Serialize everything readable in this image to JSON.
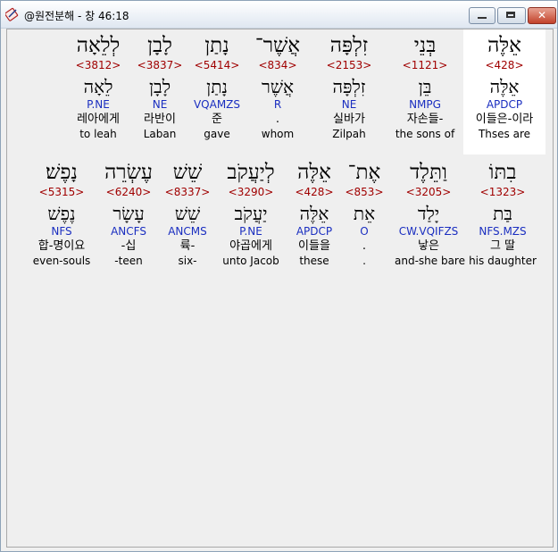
{
  "window": {
    "title": "@원전분해 - 창 46:18",
    "close_glyph": "✕"
  },
  "row1": [
    {
      "heb": "אֵלֶּה",
      "strong": "<428>",
      "lemma": "אֵלֶּה",
      "morph": "APDCP",
      "kor": "이들은-이라",
      "eng": "Thses are"
    },
    {
      "heb": "בְּנֵי",
      "strong": "<1121>",
      "lemma": "בֵּן",
      "morph": "NMPG",
      "kor": "자손들-",
      "eng": "the sons of"
    },
    {
      "heb": "זִלְפָּה",
      "strong": "<2153>",
      "lemma": "זִלְפָּה",
      "morph": "NE",
      "kor": "실바가",
      "eng": "Zilpah"
    },
    {
      "heb": "אֲשֶׁר־",
      "strong": "<834>",
      "lemma": "אֲשֶׁר",
      "morph": "R",
      "kor": ".",
      "eng": "whom"
    },
    {
      "heb": "נָתַן",
      "strong": "<5414>",
      "lemma": "נָתַן",
      "morph": "VQAMZS",
      "kor": "준",
      "eng": "gave"
    },
    {
      "heb": "לָבָן",
      "strong": "<3837>",
      "lemma": "לָבָן",
      "morph": "NE",
      "kor": "라반이",
      "eng": "Laban"
    },
    {
      "heb": "לְלֵאָה",
      "strong": "<3812>",
      "lemma": "לֵאָה",
      "morph": "P.NE",
      "kor": "레아에게",
      "eng": "to leah"
    }
  ],
  "row2": [
    {
      "heb": "בִתּוֹ",
      "strong": "<1323>",
      "lemma": "בַּת",
      "morph": "NFS.MZS",
      "kor": "그 딸",
      "eng": "his daughter"
    },
    {
      "heb": "וַתֵּלֶד",
      "strong": "<3205>",
      "lemma": "יָלַד",
      "morph": "CW.VQIFZS",
      "kor": "낳은",
      "eng": "and-she bare"
    },
    {
      "heb": "אֶת־",
      "strong": "<853>",
      "lemma": "אֵת",
      "morph": "O",
      "kor": ".",
      "eng": "."
    },
    {
      "heb": "אֵלֶּה",
      "strong": "<428>",
      "lemma": "אֵלֶּה",
      "morph": "APDCP",
      "kor": "이들을",
      "eng": "these"
    },
    {
      "heb": "לְיַעֲקֹב",
      "strong": "<3290>",
      "lemma": "יַעֲקֹב",
      "morph": "P.NE",
      "kor": "야곱에게",
      "eng": "unto Jacob"
    },
    {
      "heb": "שֵׁשׁ",
      "strong": "<8337>",
      "lemma": "שֵׁשׁ",
      "morph": "ANCMS",
      "kor": "륙-",
      "eng": "six-"
    },
    {
      "heb": "עֶשְׂרֵה",
      "strong": "<6240>",
      "lemma": "עָשָׂר",
      "morph": "ANCFS",
      "kor": "-십",
      "eng": "-teen"
    },
    {
      "heb": "נָפֶשׁ׃",
      "strong": "<5315>",
      "lemma": "נֶפֶשׁ",
      "morph": "NFS",
      "kor": "합-명이요",
      "eng": "even-souls"
    }
  ]
}
